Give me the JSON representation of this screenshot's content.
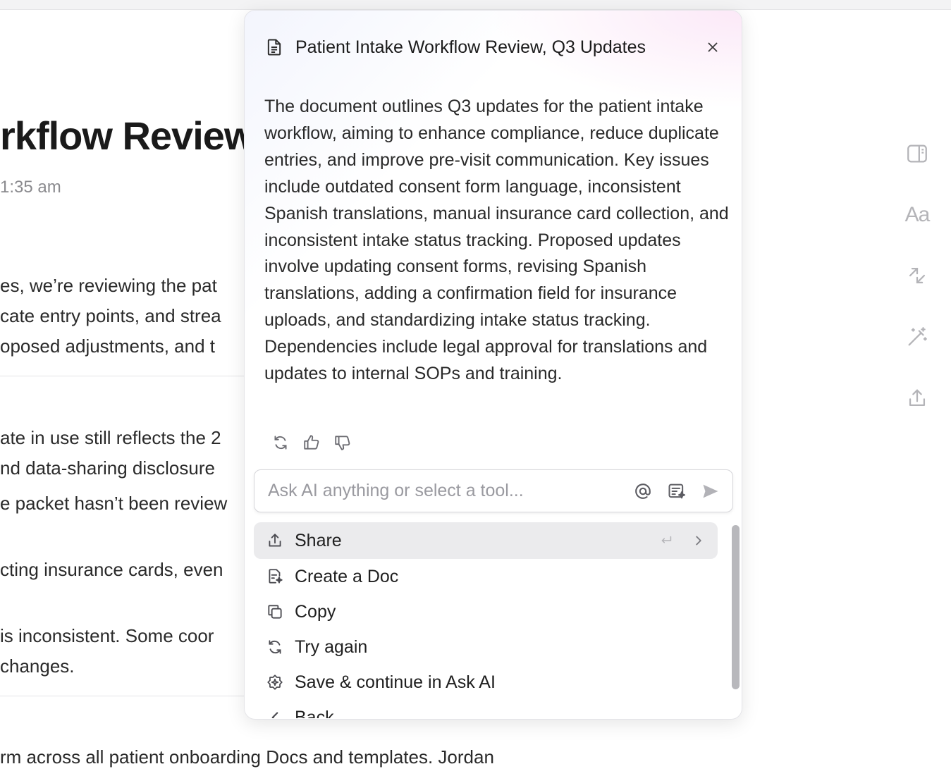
{
  "document": {
    "title_fragment": "rkflow Review",
    "meta_fragment": "1:35 am",
    "lines": [
      "es, we’re reviewing the pat",
      "cate entry points, and strea",
      "oposed adjustments, and t",
      "ate in use still reflects the 2",
      "nd data-sharing disclosure",
      "e packet hasn’t been review",
      "cting insurance cards, even",
      " is inconsistent. Some coor",
      "changes.",
      "rm across all patient onboarding Docs and templates. Jordan"
    ]
  },
  "rail": {
    "icons": [
      "sidebar-panel-icon",
      "text-format-icon",
      "collapse-arrows-icon",
      "magic-wand-icon",
      "share-upload-icon"
    ],
    "text_label": "Aa"
  },
  "panel": {
    "title": "Patient Intake Workflow Review, Q3 Updates",
    "summary": "The document outlines Q3 updates for the patient intake workflow, aiming to enhance compliance, reduce duplicate entries, and improve pre-visit communication. Key issues include outdated consent form language, inconsistent Spanish translations, manual insurance card collection, and inconsistent intake status tracking. Proposed updates involve updating consent forms, revising Spanish translations, adding a confirmation field for insurance uploads, and standardizing intake status tracking. Dependencies include legal approval for translations and updates to internal SOPs and training."
  },
  "ask": {
    "placeholder": "Ask AI anything or select a tool..."
  },
  "menu": {
    "items": [
      {
        "label": "Share",
        "icon": "share-icon"
      },
      {
        "label": "Create a Doc",
        "icon": "create-doc-icon"
      },
      {
        "label": "Copy",
        "icon": "copy-icon"
      },
      {
        "label": "Try again",
        "icon": "retry-icon"
      },
      {
        "label": "Save & continue in Ask AI",
        "icon": "ai-brain-icon"
      },
      {
        "label": "Back",
        "icon": "chevron-left-icon"
      }
    ]
  },
  "colors": {
    "accent_soft": "#f3f5fd",
    "highlight": "#ebebed",
    "muted": "#b4b4b8"
  }
}
